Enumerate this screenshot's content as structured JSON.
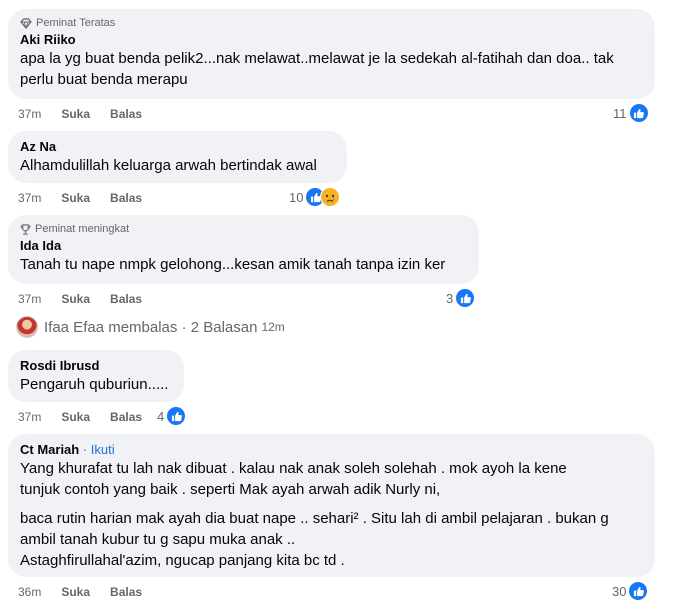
{
  "comments": [
    {
      "badge": "Peminat Teratas",
      "author": "Aki Riiko",
      "text_lines": [
        "apa la yg buat benda pelik2...nak melawat..melawat je la sedekah al-fatihah dan doa.. tak",
        "perlu buat benda merapu"
      ],
      "time": "37m",
      "like_label": "Suka",
      "reply_label": "Balas",
      "reaction_count": "11"
    },
    {
      "author": "Az Na",
      "text_lines": [
        "Alhamdulillah keluarga arwah bertindak awal"
      ],
      "time": "37m",
      "like_label": "Suka",
      "reply_label": "Balas",
      "reaction_count": "10"
    },
    {
      "badge": "Peminat meningkat",
      "author": "Ida Ida",
      "text_lines": [
        "Tanah tu nape nmpk gelohong...kesan amik tanah tanpa izin ker"
      ],
      "time": "37m",
      "like_label": "Suka",
      "reply_label": "Balas",
      "reaction_count": "3"
    },
    {
      "author": "Rosdi Ibrusd",
      "text_lines": [
        "Pengaruh quburiun....."
      ],
      "time": "37m",
      "like_label": "Suka",
      "reply_label": "Balas",
      "reaction_count": "4"
    },
    {
      "author": "Ct Mariah",
      "follow": " · Ikuti",
      "text_lines": [
        "Yang khurafat tu lah nak dibuat . kalau nak anak soleh solehah . mok ayoh la kene",
        "tunjuk contoh yang baik . seperti Mak ayah arwah adik Nurly ni,",
        "baca rutin harian mak ayah dia buat nape .. sehari² . Situ lah di ambil pelajaran . bukan g",
        "ambil tanah kubur tu g sapu muka anak ..",
        "Astaghfirullahal'azim, ngucap panjang kita bc td ."
      ],
      "time": "36m",
      "like_label": "Suka",
      "reply_label": "Balas",
      "reaction_count": "30"
    }
  ],
  "reply_summary": {
    "text": "Ifaa Efaa membalas · 2 Balasan",
    "time": "12m"
  },
  "colors": {
    "bubble": "#f0f2f5",
    "like_blue": "#1877f2",
    "link_blue": "#216fdb",
    "muted": "#65676b"
  },
  "icons": [
    "diamond-badge-icon",
    "trophy-badge-icon",
    "like-reaction-icon",
    "sad-reaction-icon",
    "avatar"
  ]
}
